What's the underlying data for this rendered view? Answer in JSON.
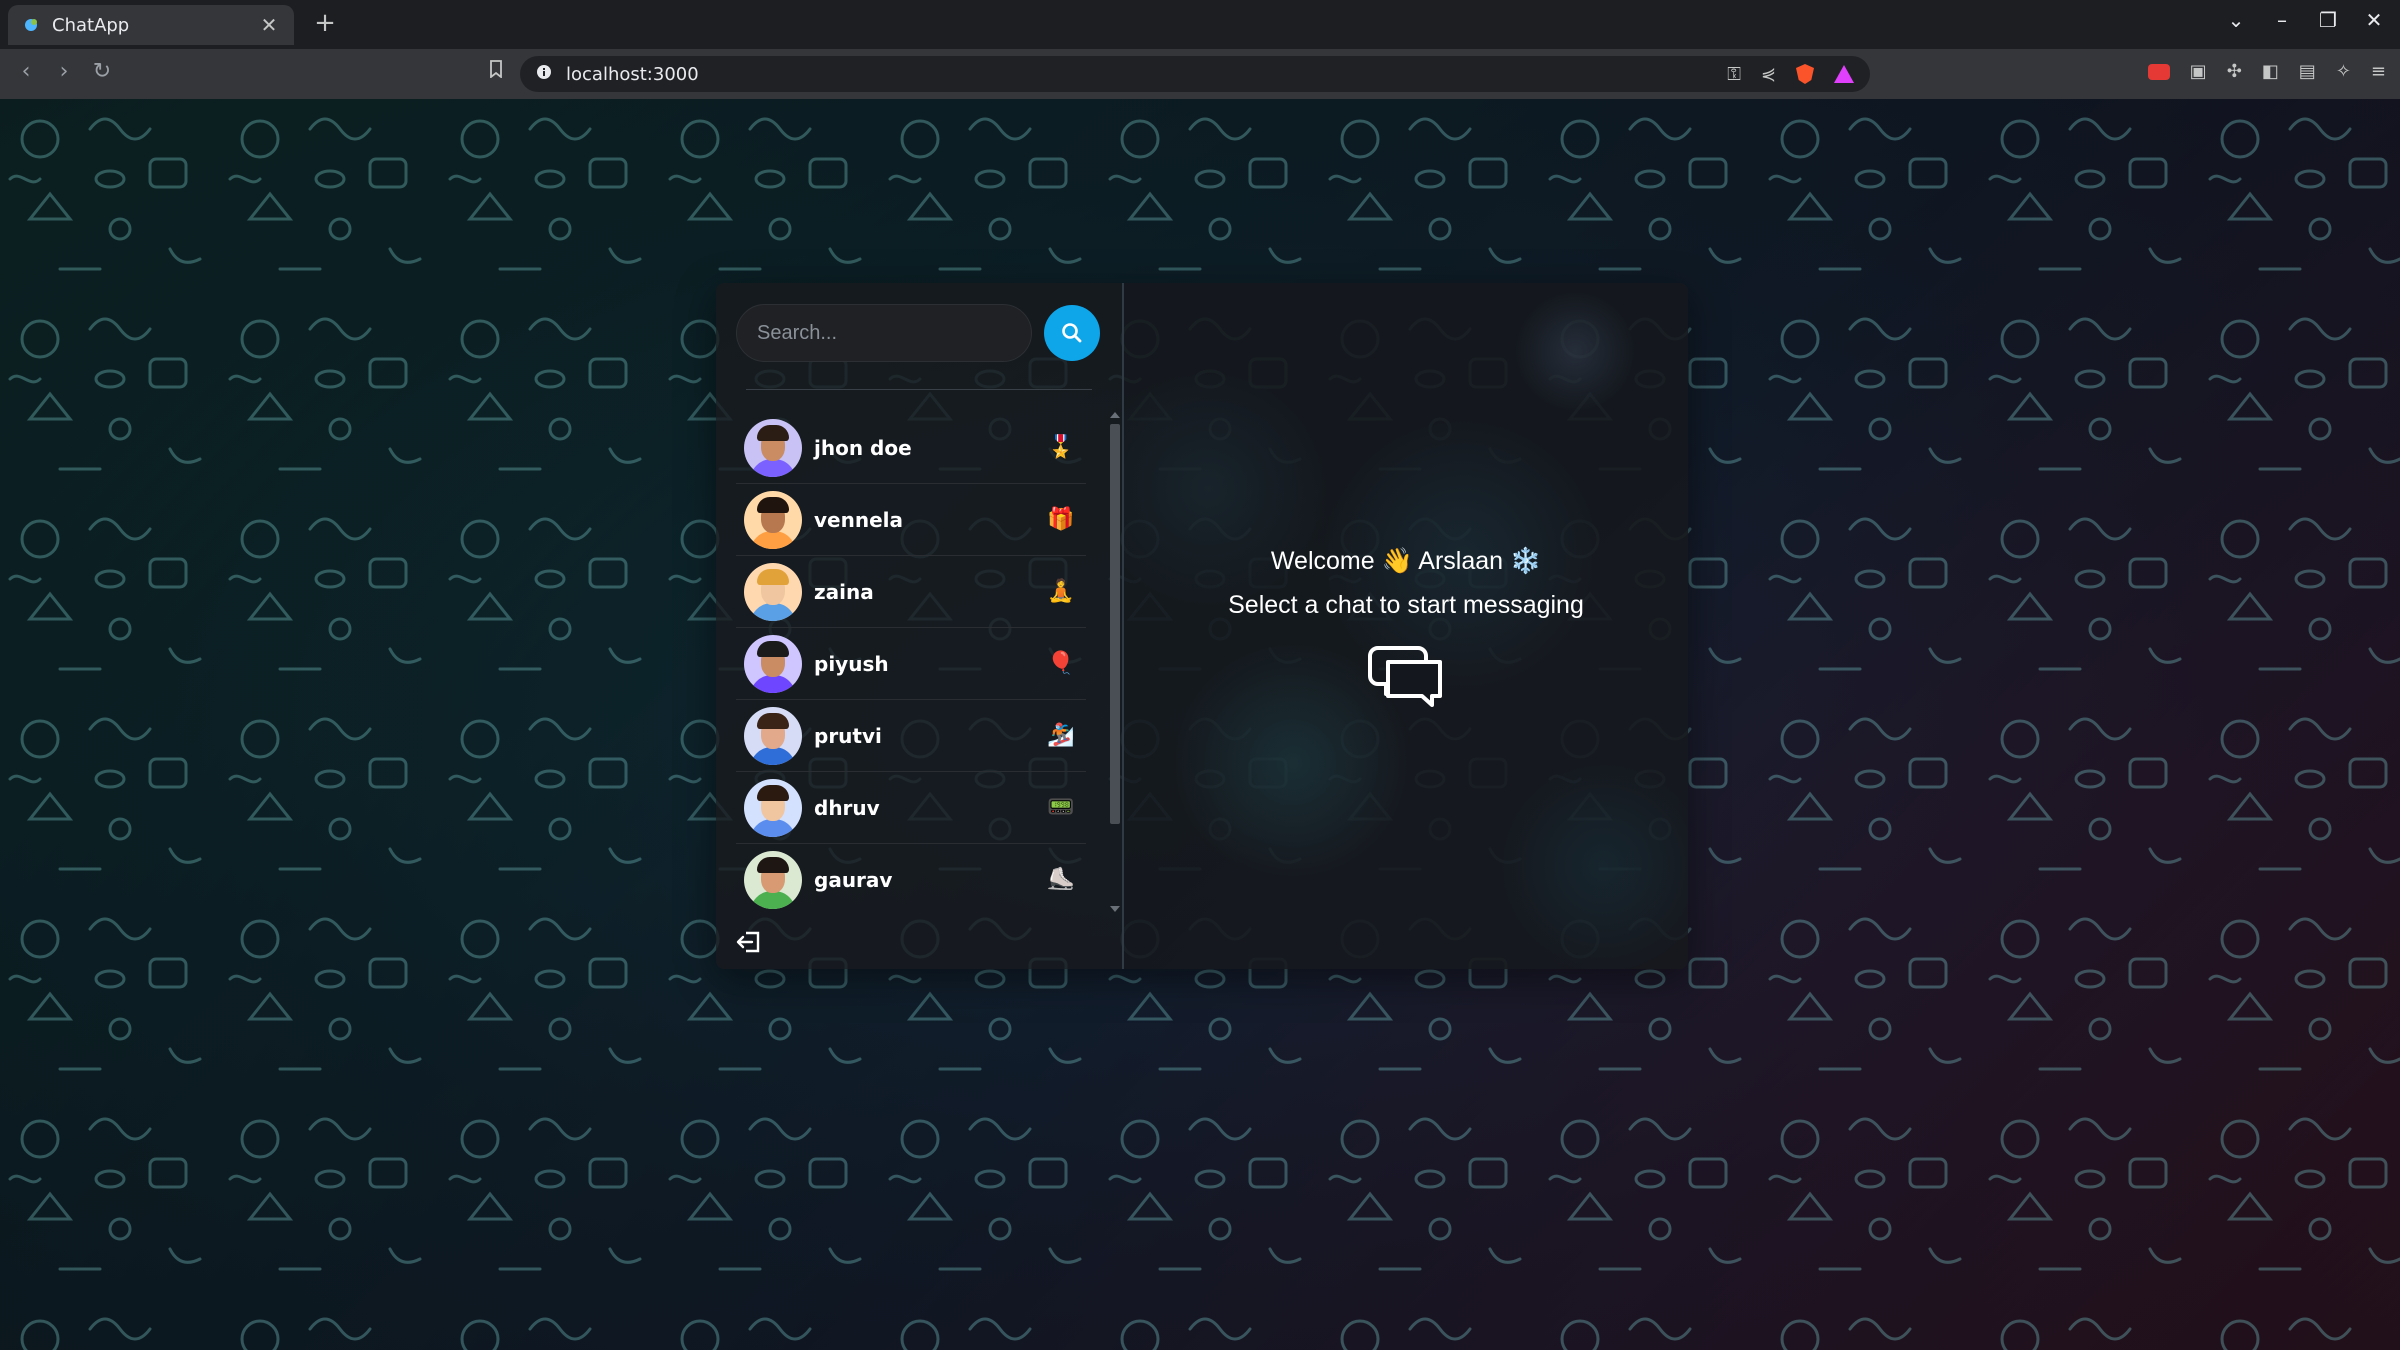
{
  "browser": {
    "tab_title": "ChatApp",
    "url": "localhost:3000"
  },
  "sidebar": {
    "search_placeholder": "Search...",
    "users": [
      {
        "name": "jhon doe",
        "emoji": "🎖️",
        "hair": "#2b1d14",
        "skin": "#c98c63",
        "shirt": "#7b61ff",
        "bg": "#c9c2f5"
      },
      {
        "name": "vennela",
        "emoji": "🎁",
        "hair": "#1f140e",
        "skin": "#b7784f",
        "shirt": "#ff9f43",
        "bg": "#ffd9a8"
      },
      {
        "name": "zaina",
        "emoji": "🧘",
        "hair": "#e2a23a",
        "skin": "#f0c6a0",
        "shirt": "#5aa0e6",
        "bg": "#ffd8b0"
      },
      {
        "name": "piyush",
        "emoji": "🎈",
        "hair": "#1b1b1b",
        "skin": "#c98c63",
        "shirt": "#6e46ff",
        "bg": "#cfc6ff"
      },
      {
        "name": "prutvi",
        "emoji": "🏂",
        "hair": "#3a2418",
        "skin": "#e2a98a",
        "shirt": "#2f6dd9",
        "bg": "#d6dcf5"
      },
      {
        "name": "dhruv",
        "emoji": "📟",
        "hair": "#2a1a10",
        "skin": "#f0c6a0",
        "shirt": "#5b8def",
        "bg": "#d3e1ff"
      },
      {
        "name": "gaurav",
        "emoji": "⛸️",
        "hair": "#1e1612",
        "skin": "#d89a72",
        "shirt": "#4caf50",
        "bg": "#dbe9d2"
      }
    ]
  },
  "main": {
    "welcome_text": "Welcome 👋 Arslaan ❄️",
    "prompt_text": "Select a chat to start messaging"
  },
  "colors": {
    "accent": "#0ea5e9",
    "text": "#ffffff"
  }
}
